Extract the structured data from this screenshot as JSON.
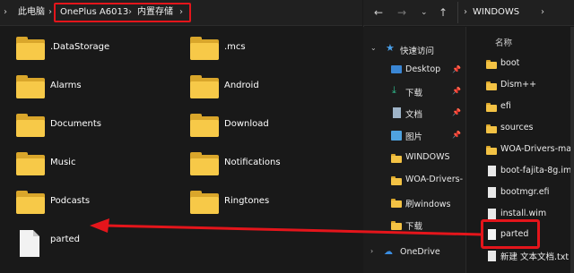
{
  "left": {
    "breadcrumb": {
      "root": "此电脑",
      "device": "OnePlus A6013",
      "storage": "内置存储"
    },
    "folders": [
      {
        "name": ".DataStorage"
      },
      {
        "name": ".mcs"
      },
      {
        "name": "Alarms"
      },
      {
        "name": "Android"
      },
      {
        "name": "Documents"
      },
      {
        "name": "Download"
      },
      {
        "name": "Music"
      },
      {
        "name": "Notifications"
      },
      {
        "name": "Podcasts"
      },
      {
        "name": "Ringtones"
      }
    ],
    "file": {
      "name": "parted"
    }
  },
  "right": {
    "nav": {
      "back_icon": "arrow-left-icon",
      "forward_icon": "arrow-right-icon",
      "down_icon": "chevron-down-icon",
      "up_icon": "arrow-up-icon"
    },
    "address": "WINDOWS",
    "sidebar": {
      "quick_access": "快速访问",
      "items": [
        {
          "label": "Desktop",
          "icon": "desktop-icon",
          "pinned": true
        },
        {
          "label": "下载",
          "icon": "download-icon",
          "pinned": true
        },
        {
          "label": "文档",
          "icon": "document-icon",
          "pinned": true
        },
        {
          "label": "图片",
          "icon": "picture-icon",
          "pinned": true
        },
        {
          "label": "WINDOWS",
          "icon": "folder-icon",
          "pinned": false
        },
        {
          "label": "WOA-Drivers-",
          "icon": "folder-icon",
          "pinned": false
        },
        {
          "label": "刷windows",
          "icon": "folder-icon",
          "pinned": false
        },
        {
          "label": "下载",
          "icon": "folder-icon",
          "pinned": false
        }
      ],
      "onedrive": "OneDrive"
    },
    "column_header": "名称",
    "files": [
      {
        "name": "boot",
        "type": "folder"
      },
      {
        "name": "Dism++",
        "type": "folder"
      },
      {
        "name": "efi",
        "type": "folder"
      },
      {
        "name": "sources",
        "type": "folder"
      },
      {
        "name": "WOA-Drivers-main",
        "type": "folder"
      },
      {
        "name": "boot-fajita-8g.img",
        "type": "file"
      },
      {
        "name": "bootmgr.efi",
        "type": "file"
      },
      {
        "name": "install.wim",
        "type": "file"
      },
      {
        "name": "parted",
        "type": "file"
      },
      {
        "name": "新建 文本文档.txt",
        "type": "file"
      }
    ]
  },
  "colors": {
    "highlight_red": "#e4151b",
    "folder_yellow": "#f7c948",
    "background": "#191919"
  }
}
